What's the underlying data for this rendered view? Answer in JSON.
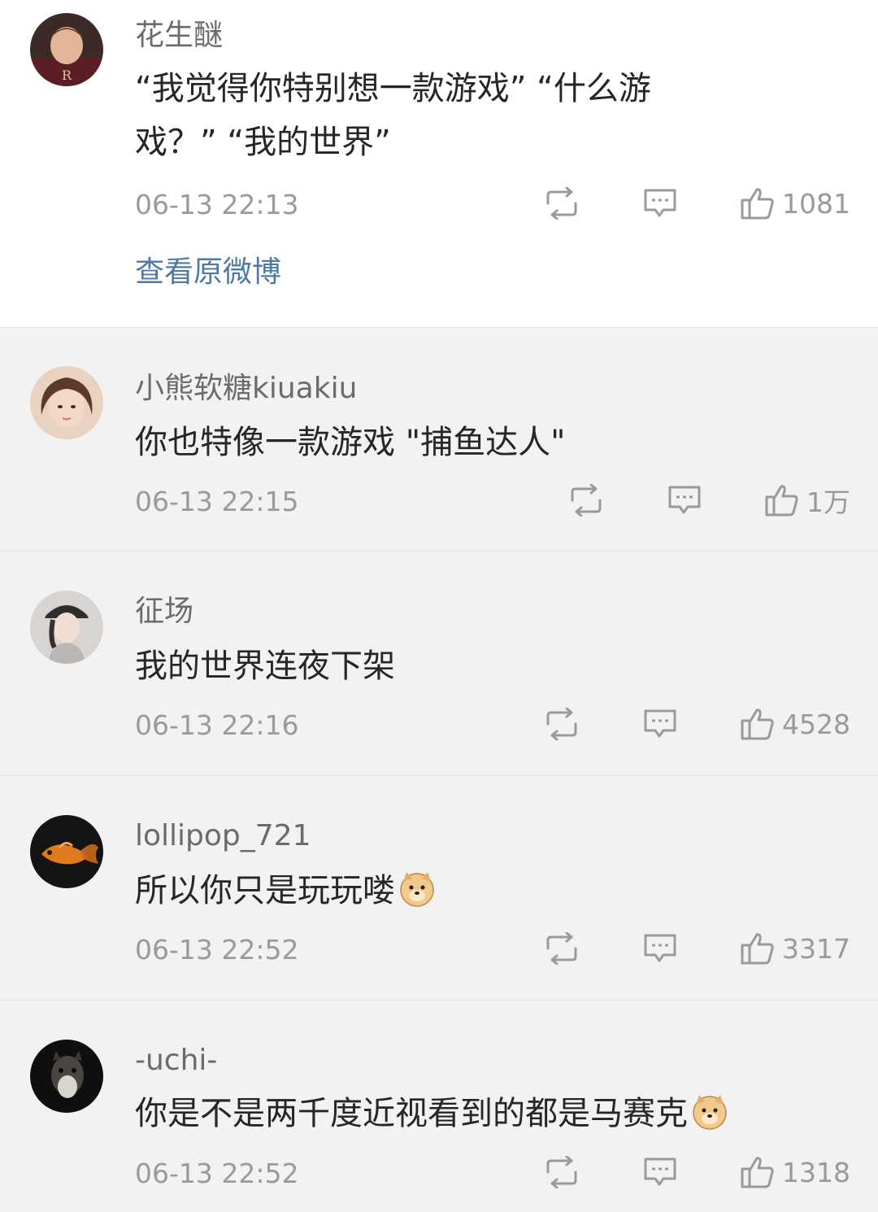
{
  "comments": [
    {
      "username": "花生醚",
      "text_line1": "“我觉得你特别想一款游戏” “什么游",
      "text_line2": "戏？” “我的世界”",
      "time": "06-13 22:13",
      "likes": "1081",
      "view_original": "查看原微博"
    },
    {
      "username": "小熊软糖kiuakiu",
      "text": "你也特像一款游戏 \"捕鱼达人\"",
      "time": "06-13 22:15",
      "likes": "1万"
    },
    {
      "username": "征场",
      "text": "我的世界连夜下架",
      "time": "06-13 22:16",
      "likes": "4528"
    },
    {
      "username": "lollipop_721",
      "text": "所以你只是玩玩喽",
      "time": "06-13 22:52",
      "likes": "3317"
    },
    {
      "username": "-uchi-",
      "text": "你是不是两千度近视看到的都是马赛克",
      "time": "06-13 22:52",
      "likes": "1318"
    }
  ],
  "icons": {
    "repost": "repost-icon",
    "comment": "comment-icon",
    "like": "thumbs-up-icon",
    "emoji": "doge-emoji-icon"
  },
  "colors": {
    "reply_background": "#f2f2f2",
    "link": "#4d79a6",
    "meta": "#9a9a9a"
  }
}
